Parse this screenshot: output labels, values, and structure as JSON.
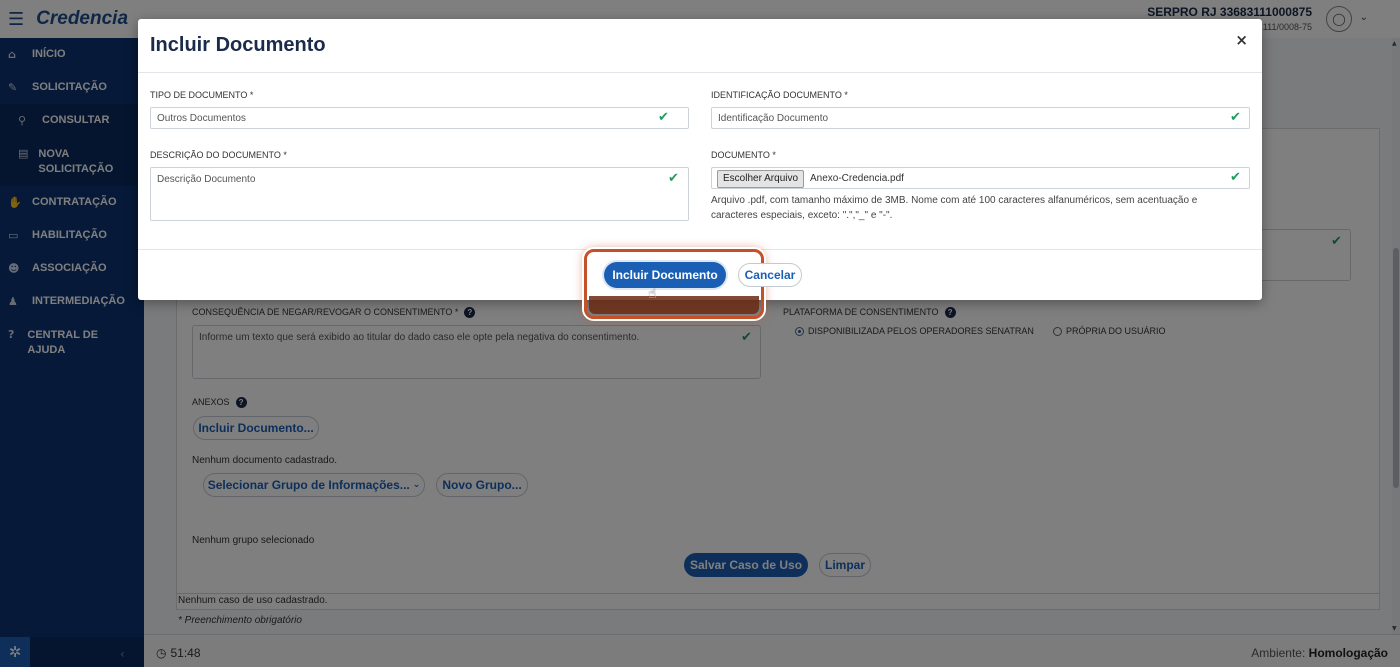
{
  "header": {
    "brand": "Credencia",
    "menu_icon": "hamburger-icon",
    "user_name": "SERPRO RJ 33683111000875",
    "user_cnpj": "111/0008-75",
    "avatar_icon": "user-icon",
    "caret_icon": "chevron-down-icon"
  },
  "sidebar": {
    "items": [
      {
        "label": "Início",
        "icon": "home-icon"
      },
      {
        "label": "Solicitação",
        "icon": "edit-icon"
      },
      {
        "label": "Consultar",
        "icon": "search-icon"
      },
      {
        "label": "Nova Solicitação",
        "icon": "file-icon"
      },
      {
        "label": "Contratação",
        "icon": "handshake-icon"
      },
      {
        "label": "Habilitação",
        "icon": "id-card-icon"
      },
      {
        "label": "Associação",
        "icon": "users-icon"
      },
      {
        "label": "Intermediação",
        "icon": "user-tie-icon"
      },
      {
        "label": "Central de Ajuda",
        "icon": "help-icon"
      }
    ]
  },
  "form": {
    "consequence_label": "CONSEQUÊNCIA DE NEGAR/REVOGAR O CONSENTIMENTO *",
    "consequence_placeholder": "Informe um texto que será exibido ao titular do dado caso ele opte pela negativa do consentimento.",
    "platform_label": "PLATAFORMA DE CONSENTIMENTO",
    "platform_options": [
      "DISPONIBILIZADA PELOS OPERADORES SENATRAN",
      "PRÓPRIA DO USUÁRIO"
    ],
    "platform_selected": "DISPONIBILIZADA PELOS OPERADORES SENATRAN",
    "attachments_label": "ANEXOS",
    "include_document_button": "Incluir Documento...",
    "no_documents": "Nenhum documento cadastrado.",
    "select_group_button": "Selecionar Grupo de Informações...",
    "new_group_button": "Novo Grupo...",
    "no_group": "Nenhum grupo selecionado",
    "save_button": "Salvar Caso de Uso",
    "clear_button": "Limpar",
    "no_use_case": "Nenhum caso de uso cadastrado.",
    "required_note": "* Preenchimento obrigatório"
  },
  "modal": {
    "title": "Incluir Documento",
    "close_label": "×",
    "doc_type_label": "TIPO DE DOCUMENTO *",
    "doc_type_value": "Outros Documentos",
    "doc_id_label": "IDENTIFICAÇÃO DOCUMENTO *",
    "doc_id_value": "Identificação Documento",
    "description_label": "DESCRIÇÃO DO DOCUMENTO *",
    "description_value": "Descrição Documento",
    "document_label": "DOCUMENTO *",
    "choose_file_button": "Escolher Arquivo",
    "file_name": "Anexo-Credencia.pdf",
    "file_help": "Arquivo .pdf, com tamanho máximo de 3MB. Nome com até 100 caracteres alfanuméricos, sem acentuação e caracteres especiais, exceto: \".\",\"_\" e \"-\".",
    "include_button": "Incluir Documento",
    "cancel_button": "Cancelar"
  },
  "footer": {
    "timer": "51:48",
    "env_label": "Ambiente:",
    "env_value": "Homologação"
  },
  "colors": {
    "sidebar": "#0d3372",
    "primary": "#1b5fb5",
    "valid_check": "#1f9b5b",
    "highlight": "#c4512a"
  }
}
